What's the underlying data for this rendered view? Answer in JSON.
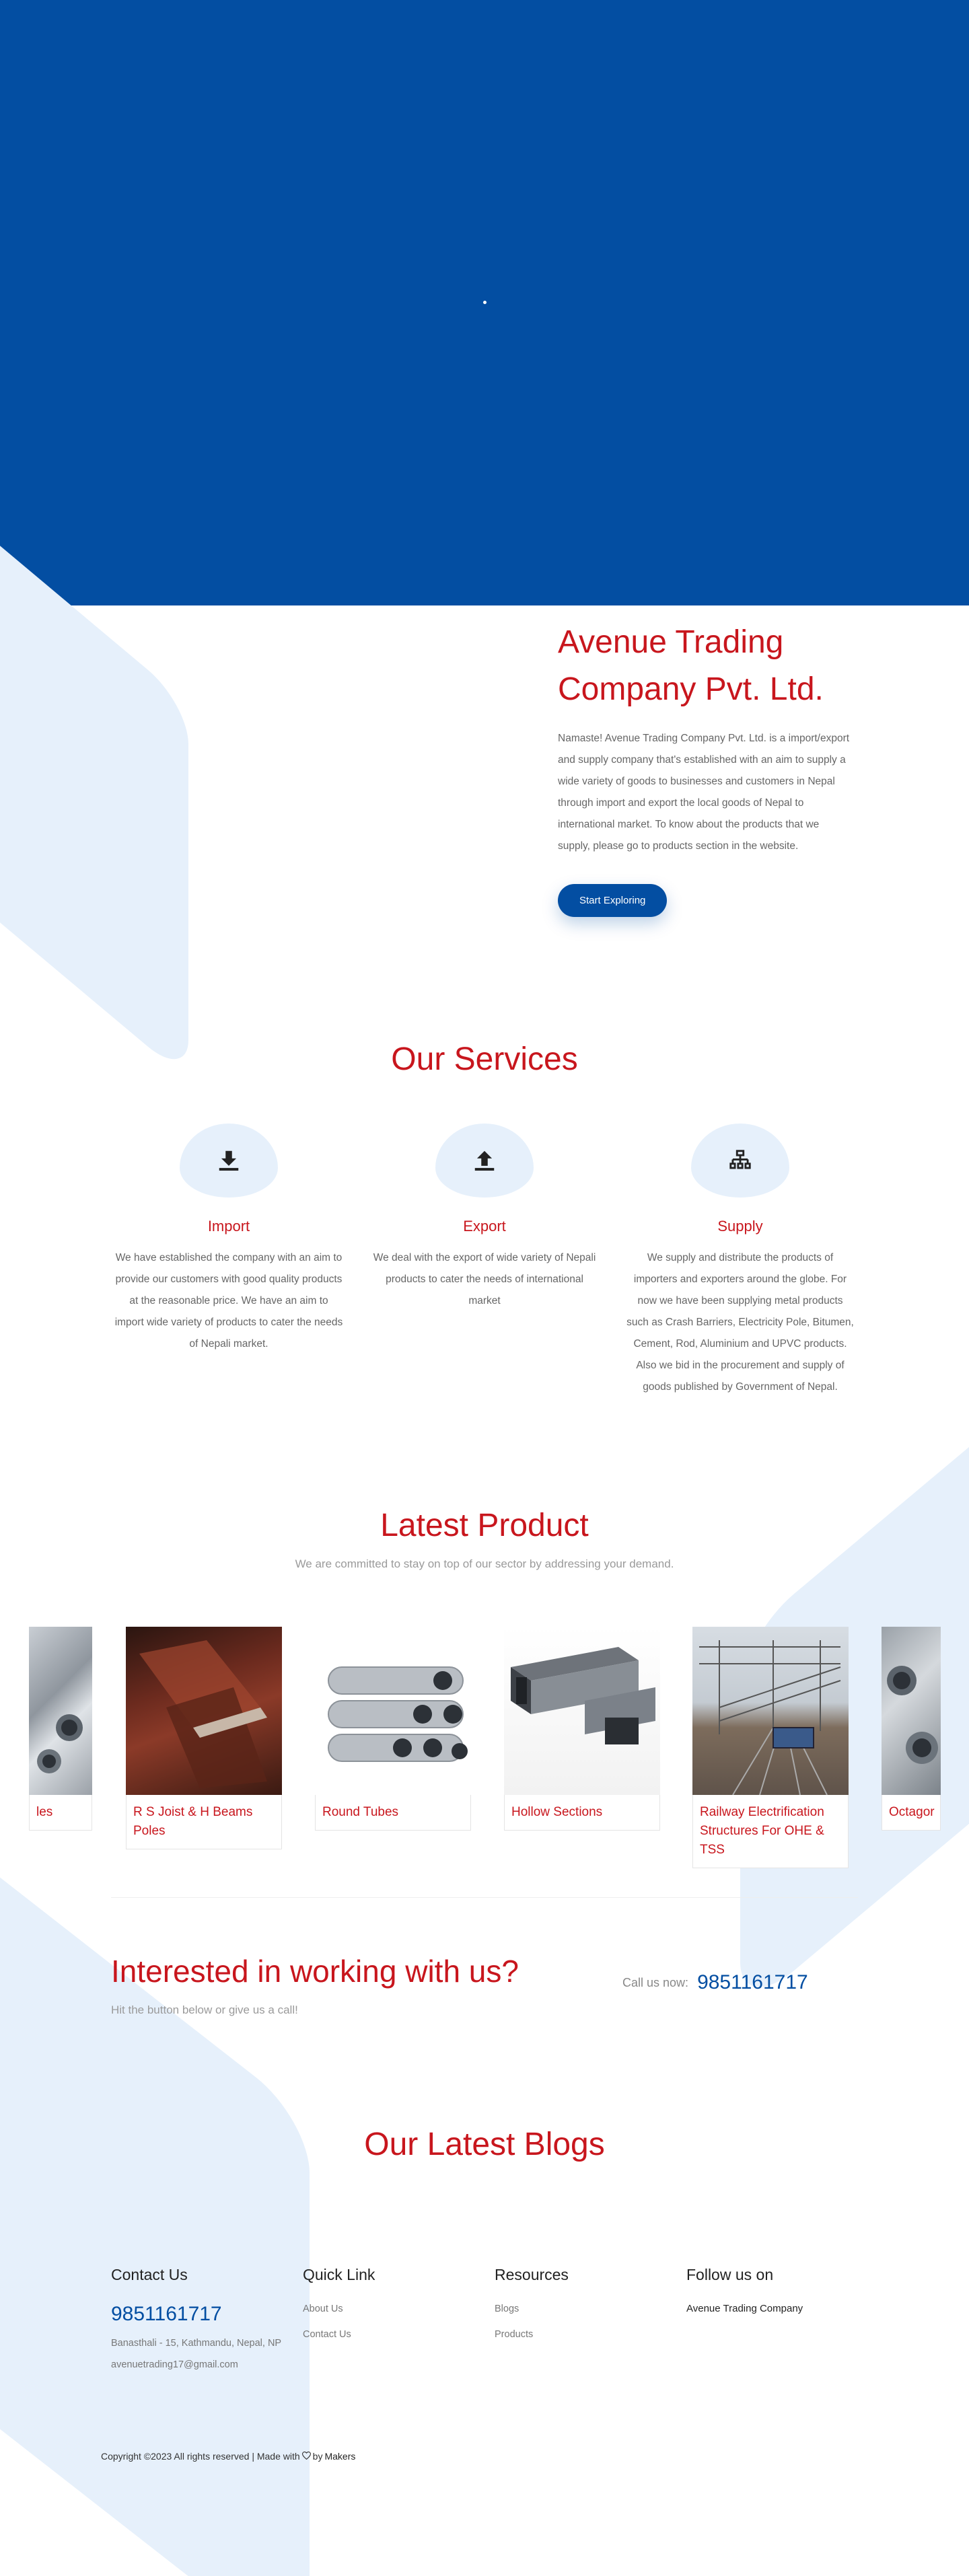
{
  "about": {
    "title": "Avenue Trading Company Pvt. Ltd.",
    "text": "Namaste! Avenue Trading Company Pvt. Ltd. is a import/export and supply company that's established with an aim to supply a wide variety of goods to businesses and customers in Nepal through import and export the local goods of Nepal to international market. To know about the products that we supply, please go to products section in the website.",
    "button": "Start Exploring"
  },
  "services": {
    "title": "Our Services",
    "items": [
      {
        "name": "Import",
        "icon": "download-icon",
        "text": "We have established the company with an aim to provide our customers with good quality products at the reasonable price. We have an aim to import wide variety of products to cater the needs of Nepali market."
      },
      {
        "name": "Export",
        "icon": "upload-icon",
        "text": "We deal with the export of wide variety of Nepali products to cater the needs of international market"
      },
      {
        "name": "Supply",
        "icon": "network-icon",
        "text": "We supply and distribute the products of importers and exporters around the globe. For now we have been supplying metal products such as Crash Barriers, Electricity Pole, Bitumen, Cement, Rod, Aluminium and UPVC products. Also we bid in the procurement and supply of goods published by Government of Nepal."
      }
    ]
  },
  "products": {
    "title": "Latest Product",
    "subtitle": "We are committed to stay on top of our sector by addressing your demand.",
    "items": [
      {
        "name": "les"
      },
      {
        "name": "R S Joist & H Beams Poles"
      },
      {
        "name": "Round Tubes"
      },
      {
        "name": "Hollow Sections"
      },
      {
        "name": "Railway Electrification Structures For OHE & TSS"
      },
      {
        "name": "Octagor"
      }
    ]
  },
  "cta": {
    "title": "Interested in working with us?",
    "subtitle": "Hit the button below or give us a call!",
    "call_label": "Call us now:",
    "phone": "9851161717"
  },
  "blogs": {
    "title": "Our Latest Blogs"
  },
  "footer": {
    "contact": {
      "heading": "Contact Us",
      "phone": "9851161717",
      "address": "Banasthali - 15, Kathmandu, Nepal, NP",
      "email": "avenuetrading17@gmail.com"
    },
    "quick_link": {
      "heading": "Quick Link",
      "links": [
        "About Us",
        "Contact Us"
      ]
    },
    "resources": {
      "heading": "Resources",
      "links": [
        "Blogs",
        "Products"
      ]
    },
    "follow": {
      "heading": "Follow us on",
      "link": "Avenue Trading Company"
    },
    "copyright": "Copyright ©2023 All rights reserved | Made with",
    "made_by_prefix": "by",
    "made_by": "Makers"
  },
  "colors": {
    "brand_blue": "#034ea2",
    "accent_red": "#c8161d",
    "light_blue": "#e6f0fb"
  }
}
